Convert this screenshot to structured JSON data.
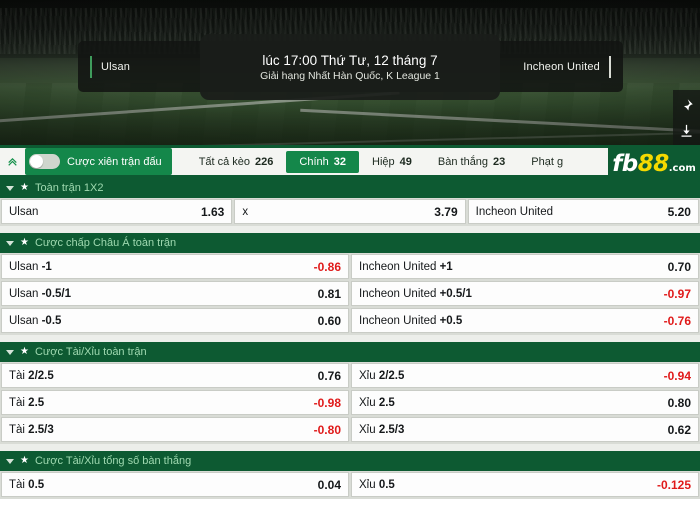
{
  "hero": {
    "home_team": "Ulsan",
    "away_team": "Incheon United",
    "match_time": "lúc 17:00 Thứ Tư, 12 tháng 7",
    "league": "Giải hạng Nhất Hàn Quốc, K League 1",
    "rail_icons": [
      "pin-icon",
      "download-icon"
    ]
  },
  "toolbar": {
    "collapse_icon": "chevron-up-icon",
    "parlay_label": "Cược xiên trận đấu",
    "parlay_enabled": false,
    "tabs": [
      {
        "label": "Tất cả kèo",
        "count": "226",
        "active": false
      },
      {
        "label": "Chính",
        "count": "32",
        "active": true
      },
      {
        "label": "Hiệp",
        "count": "49",
        "active": false
      },
      {
        "label": "Bàn thắng",
        "count": "23",
        "active": false
      },
      {
        "label": "Phạt g",
        "count": "",
        "active": false
      }
    ],
    "logo": {
      "fb": "fb",
      "eightyeight": "88",
      "com": ".com"
    }
  },
  "sections": [
    {
      "title": "Toàn trận 1X2",
      "rows": [
        [
          {
            "label": "Ulsan",
            "bold": "",
            "odd": "1.63",
            "negative": false
          },
          {
            "label": "x",
            "bold": "",
            "odd": "3.79",
            "negative": false
          },
          {
            "label": "Incheon United",
            "bold": "",
            "odd": "5.20",
            "negative": false
          }
        ]
      ]
    },
    {
      "title": "Cược chấp Châu Á toàn trận",
      "rows": [
        [
          {
            "label": "Ulsan",
            "bold": "-1",
            "odd": "-0.86",
            "negative": true
          },
          {
            "label": "Incheon United",
            "bold": "+1",
            "odd": "0.70",
            "negative": false
          }
        ],
        [
          {
            "label": "Ulsan",
            "bold": "-0.5/1",
            "odd": "0.81",
            "negative": false
          },
          {
            "label": "Incheon United",
            "bold": "+0.5/1",
            "odd": "-0.97",
            "negative": true
          }
        ],
        [
          {
            "label": "Ulsan",
            "bold": "-0.5",
            "odd": "0.60",
            "negative": false
          },
          {
            "label": "Incheon United",
            "bold": "+0.5",
            "odd": "-0.76",
            "negative": true
          }
        ]
      ]
    },
    {
      "title": "Cược Tài/Xỉu toàn trận",
      "rows": [
        [
          {
            "label": "Tài",
            "bold": "2/2.5",
            "odd": "0.76",
            "negative": false
          },
          {
            "label": "Xỉu",
            "bold": "2/2.5",
            "odd": "-0.94",
            "negative": true
          }
        ],
        [
          {
            "label": "Tài",
            "bold": "2.5",
            "odd": "-0.98",
            "negative": true
          },
          {
            "label": "Xỉu",
            "bold": "2.5",
            "odd": "0.80",
            "negative": false
          }
        ],
        [
          {
            "label": "Tài",
            "bold": "2.5/3",
            "odd": "-0.80",
            "negative": true
          },
          {
            "label": "Xỉu",
            "bold": "2.5/3",
            "odd": "0.62",
            "negative": false
          }
        ]
      ]
    },
    {
      "title": "Cược Tài/Xỉu tổng số bàn thắng",
      "rows": [
        [
          {
            "label": "Tài",
            "bold": "0.5",
            "odd": "0.04",
            "negative": false
          },
          {
            "label": "Xỉu",
            "bold": "0.5",
            "odd": "-0.125",
            "negative": true
          }
        ]
      ]
    }
  ]
}
